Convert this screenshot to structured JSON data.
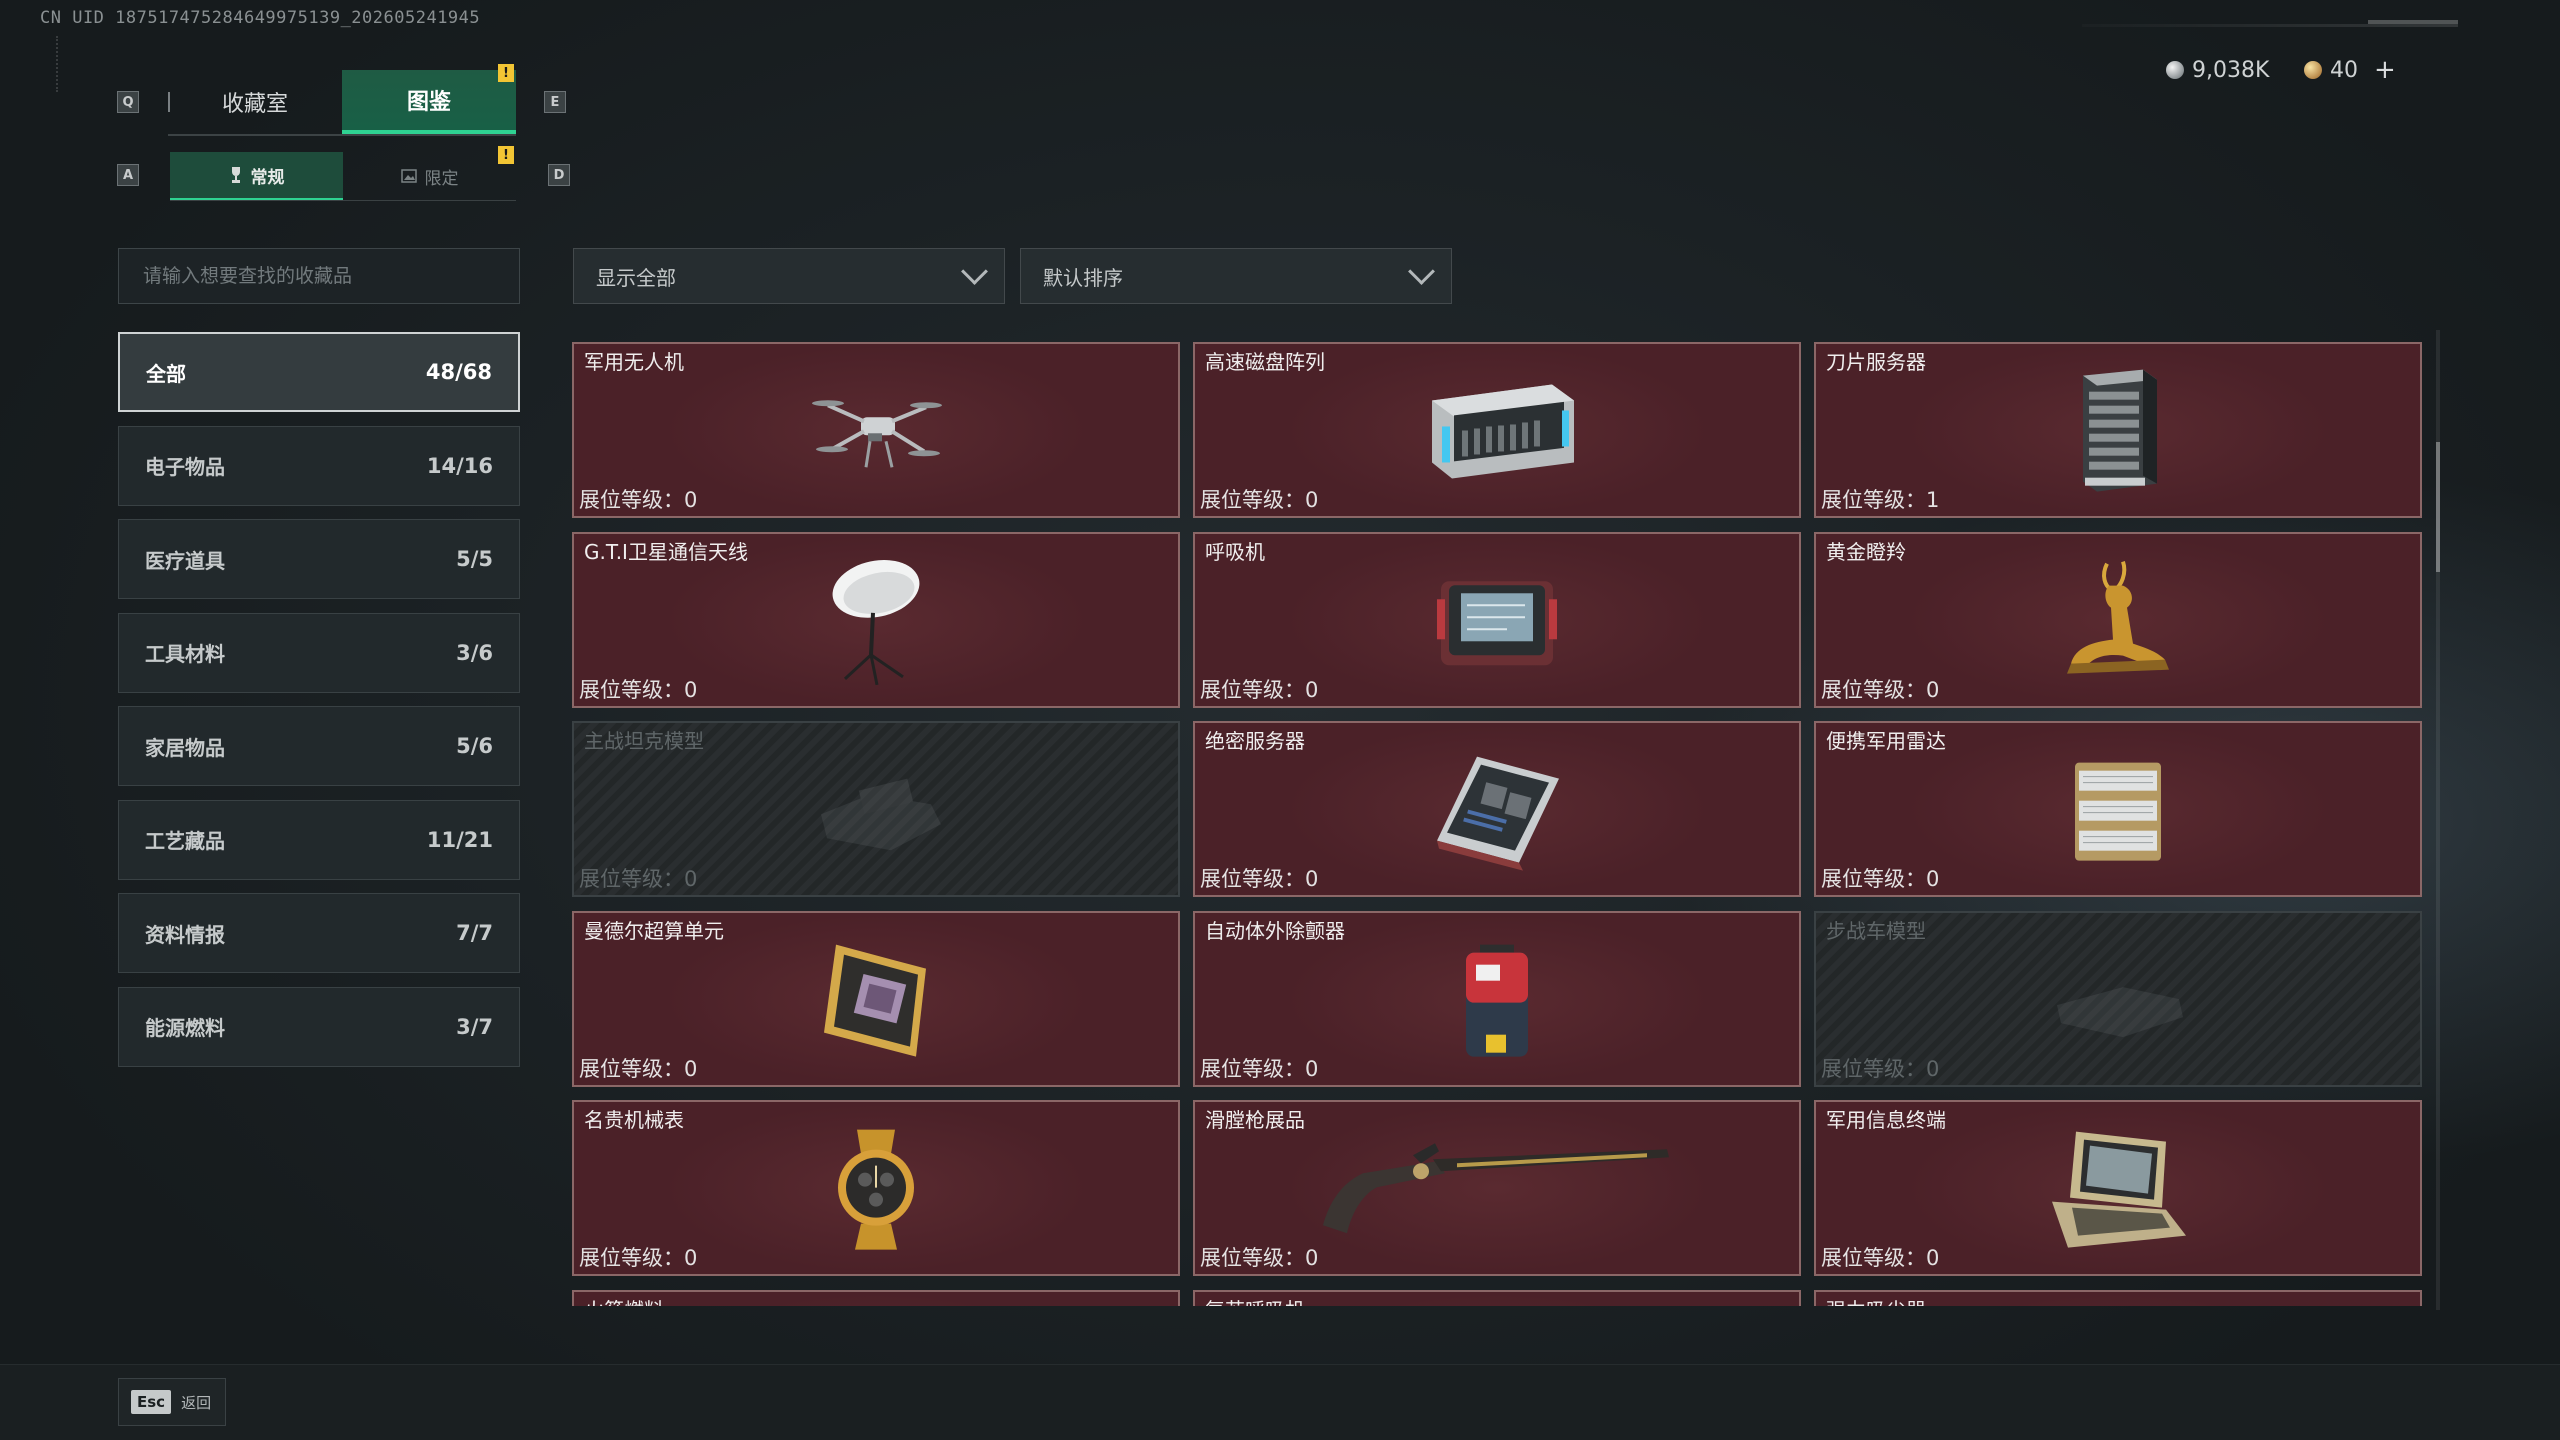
{
  "uid": "CN UID 18751747528464997513​9_202605241945",
  "currency": {
    "silver": {
      "icon": "silver-coin-icon",
      "value": "9,038K"
    },
    "gold": {
      "icon": "gold-coin-icon",
      "value": "40",
      "add_label": "+"
    }
  },
  "key_hints": {
    "prev_tab": "Q",
    "next_tab": "E",
    "prev_sub": "A",
    "next_sub": "D"
  },
  "tabs": [
    {
      "label": "收藏室",
      "active": false
    },
    {
      "label": "图鉴",
      "active": true,
      "badge": "!"
    }
  ],
  "subtabs": [
    {
      "label": "常规",
      "icon": "trophy-icon",
      "active": true,
      "badge": "!"
    },
    {
      "label": "限定",
      "icon": "image-icon",
      "active": false
    }
  ],
  "search": {
    "placeholder": "请输入想要查找的收藏品",
    "value": ""
  },
  "categories": [
    {
      "label": "全部",
      "count": "48/68",
      "active": true
    },
    {
      "label": "电子物品",
      "count": "14/16"
    },
    {
      "label": "医疗道具",
      "count": "5/5"
    },
    {
      "label": "工具材料",
      "count": "3/6"
    },
    {
      "label": "家居物品",
      "count": "5/6"
    },
    {
      "label": "工艺藏品",
      "count": "11/21"
    },
    {
      "label": "资料情报",
      "count": "7/7"
    },
    {
      "label": "能源燃料",
      "count": "3/7"
    }
  ],
  "filter": {
    "value": "显示全部",
    "icon": "chevron-down-icon"
  },
  "sort": {
    "value": "默认排序",
    "icon": "chevron-down-icon"
  },
  "items": [
    {
      "name": "军用无人机",
      "level": "展位等级：0",
      "icon": "drone-icon",
      "locked": false
    },
    {
      "name": "高速磁盘阵列",
      "level": "展位等级：0",
      "icon": "disk-array-icon",
      "locked": false
    },
    {
      "name": "刀片服务器",
      "level": "展位等级：1",
      "icon": "blade-server-icon",
      "locked": false
    },
    {
      "name": "G.T.I卫星通信天线",
      "level": "展位等级：0",
      "icon": "satellite-dish-icon",
      "locked": false
    },
    {
      "name": "呼吸机",
      "level": "展位等级：0",
      "icon": "ventilator-icon",
      "locked": false
    },
    {
      "name": "黄金瞪羚",
      "level": "展位等级：0",
      "icon": "gold-gazelle-icon",
      "locked": false
    },
    {
      "name": "主战坦克模型",
      "level": "展位等级：0",
      "icon": "tank-model-icon",
      "locked": true
    },
    {
      "name": "绝密服务器",
      "level": "展位等级：0",
      "icon": "server-board-icon",
      "locked": false
    },
    {
      "name": "便携军用雷达",
      "level": "展位等级：0",
      "icon": "portable-radar-icon",
      "locked": false
    },
    {
      "name": "曼德尔超算单元",
      "level": "展位等级：0",
      "icon": "compute-unit-icon",
      "locked": false
    },
    {
      "name": "自动体外除颤器",
      "level": "展位等级：0",
      "icon": "defibrillator-icon",
      "locked": false
    },
    {
      "name": "步战车模型",
      "level": "展位等级：0",
      "icon": "ifv-model-icon",
      "locked": true
    },
    {
      "name": "名贵机械表",
      "level": "展位等级：0",
      "icon": "watch-icon",
      "locked": false
    },
    {
      "name": "滑膛枪展品",
      "level": "展位等级：0",
      "icon": "musket-icon",
      "locked": false
    },
    {
      "name": "军用信息终端",
      "level": "展位等级：0",
      "icon": "terminal-case-icon",
      "locked": false
    },
    {
      "name": "火箭燃料",
      "level": "",
      "icon": "",
      "locked": false
    },
    {
      "name": "复苏呼吸机",
      "level": "",
      "icon": "",
      "locked": false
    },
    {
      "name": "强力吸尘器",
      "level": "",
      "icon": "",
      "locked": false
    }
  ],
  "footer": {
    "esc_key": "Esc",
    "back_label": "返回"
  }
}
